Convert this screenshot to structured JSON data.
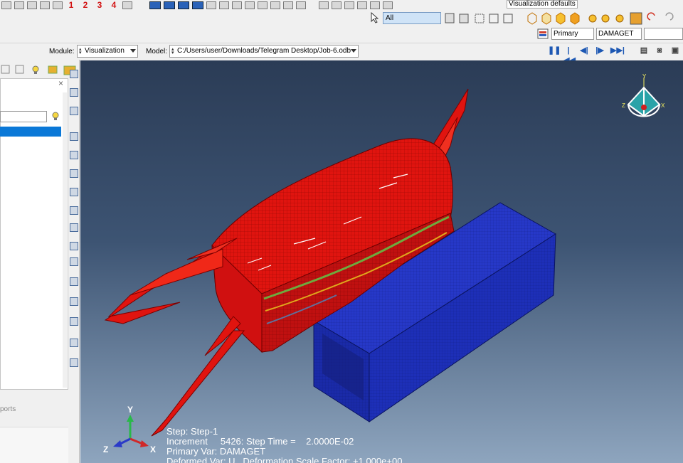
{
  "toolbar": {
    "view_numbers": [
      "1",
      "2",
      "3",
      "4"
    ],
    "viz_defaults": "Visualization defaults",
    "selection_filter": "All",
    "field_output_primary": "Primary",
    "field_output_variable": "DAMAGET"
  },
  "context": {
    "module_label": "Module:",
    "module_value": "Visualization",
    "model_label": "Model:",
    "model_value": "C:/Users/user/Downloads/Telegram Desktop/Job-6.odb"
  },
  "left_panel": {
    "reports_label": "ports"
  },
  "viewport": {
    "triad": {
      "x": "X",
      "y": "Y",
      "z": "Z"
    },
    "view_cube": {
      "x": "X",
      "y": "Y",
      "z": "Z"
    },
    "state_block": {
      "step": "Step: Step-1",
      "increment": "Increment     5426: Step Time =    2.0000E-02",
      "primary_var": "Primary Var: DAMAGET",
      "deformed_var": "Deformed Var: U   Deformation Scale Factor: +1.000e+00"
    }
  },
  "colors": {
    "specimen_red": "#e0140f",
    "box_blue": "#1d2fb8",
    "bg_top": "#2b3c56",
    "bg_bottom": "#8ea5be",
    "accent": "#0a78d7"
  }
}
